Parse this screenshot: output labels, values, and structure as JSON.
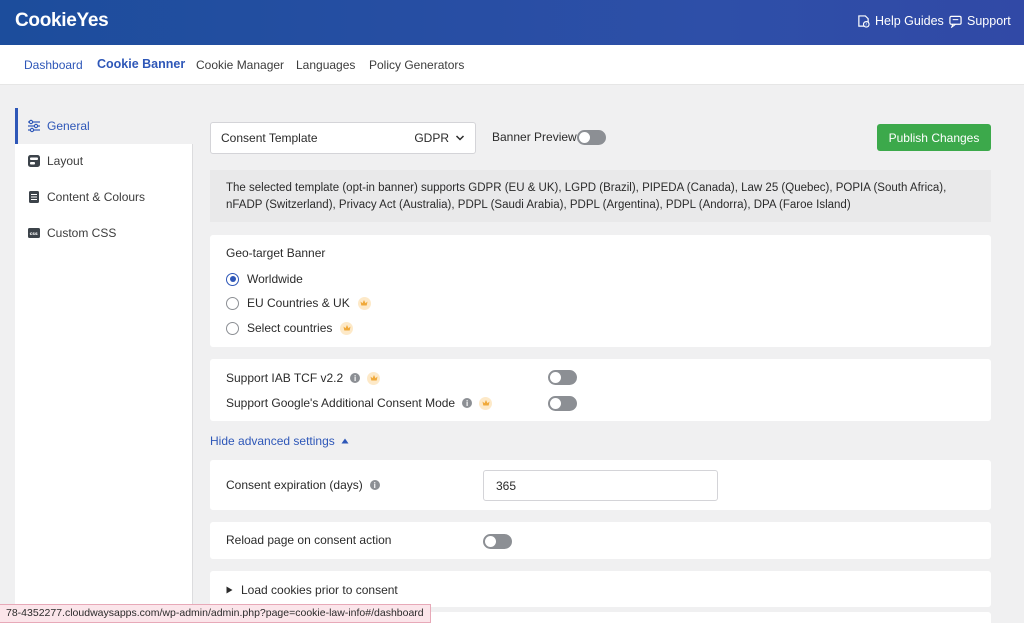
{
  "header": {
    "logo": "CookieYes",
    "help_label": "Help Guides",
    "support_label": "Support"
  },
  "nav": {
    "items": [
      "Dashboard",
      "Cookie Banner",
      "Cookie Manager",
      "Languages",
      "Policy Generators"
    ],
    "active": "Cookie Banner"
  },
  "sidebar": {
    "items": [
      {
        "label": "General",
        "icon": "sliders-icon",
        "active": true
      },
      {
        "label": "Layout",
        "icon": "layout-icon"
      },
      {
        "label": "Content & Colours",
        "icon": "document-icon"
      },
      {
        "label": "Custom CSS",
        "icon": "css-icon"
      }
    ]
  },
  "toolbar": {
    "template_label": "Consent Template",
    "template_value": "GDPR",
    "preview_label": "Banner Preview",
    "preview_on": false,
    "publish_label": "Publish Changes"
  },
  "info": {
    "text": "The selected template (opt-in banner) supports GDPR (EU & UK), LGPD (Brazil), PIPEDA (Canada), Law 25 (Quebec), POPIA (South Africa), nFADP (Switzerland), Privacy Act (Australia), PDPL (Saudi Arabia), PDPL (Argentina), PDPL (Andorra), DPA (Faroe Island)"
  },
  "geo": {
    "title": "Geo-target Banner",
    "options": [
      {
        "label": "Worldwide",
        "checked": true,
        "premium": false
      },
      {
        "label": "EU Countries & UK",
        "checked": false,
        "premium": true
      },
      {
        "label": "Select countries",
        "checked": false,
        "premium": true
      }
    ]
  },
  "support": {
    "iab_label": "Support IAB TCF v2.2",
    "iab_on": false,
    "gacm_label": "Support Google's Additional Consent Mode",
    "gacm_on": false
  },
  "advanced": {
    "toggle_label": "Hide advanced settings",
    "expiration_label": "Consent expiration (days)",
    "expiration_value": "365",
    "reload_label": "Reload page on consent action",
    "reload_on": false,
    "load_cookies_label": "Load cookies prior to consent"
  },
  "status_url": "78-4352277.cloudwaysapps.com/wp-admin/admin.php?page=cookie-law-info#/dashboard",
  "colors": {
    "brand": "#2e57b8",
    "publish": "#3ca94b",
    "premium": "#f0a93a"
  }
}
